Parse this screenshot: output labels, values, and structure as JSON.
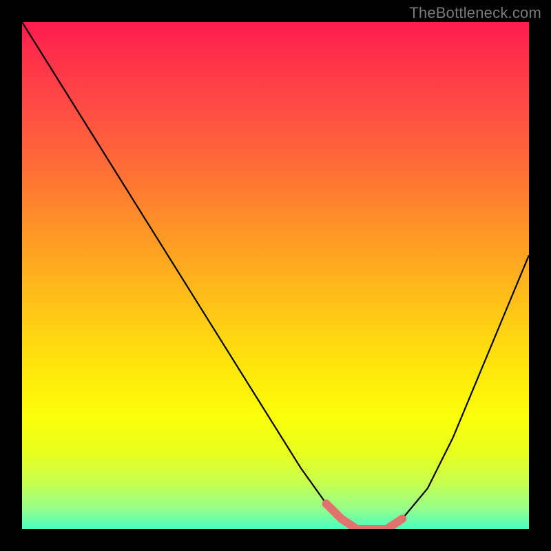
{
  "watermark": "TheBottleneck.com",
  "palette": {
    "black_frame": "#000000",
    "curve_main": "#000000",
    "curve_accent": "#e2726e",
    "watermark_color": "#7b7b7b"
  },
  "chart_data": {
    "type": "line",
    "title": "",
    "xlabel": "",
    "ylabel": "",
    "xlim": [
      0,
      100
    ],
    "ylim": [
      0,
      100
    ],
    "x": [
      0,
      5,
      10,
      15,
      20,
      25,
      30,
      35,
      40,
      45,
      50,
      55,
      60,
      63,
      66,
      69,
      72,
      75,
      80,
      85,
      90,
      95,
      100
    ],
    "series": [
      {
        "name": "bottleneck-curve",
        "values": [
          100,
          92,
          84,
          76,
          68,
          60,
          52,
          44,
          36,
          28,
          20,
          12,
          5,
          2,
          0,
          0,
          0,
          2,
          8,
          18,
          30,
          42,
          54
        ]
      }
    ],
    "accent_segment": {
      "name": "optimal-range",
      "x": [
        60,
        63,
        66,
        69,
        72,
        75
      ],
      "values": [
        5,
        2,
        0,
        0,
        0,
        2
      ]
    }
  }
}
